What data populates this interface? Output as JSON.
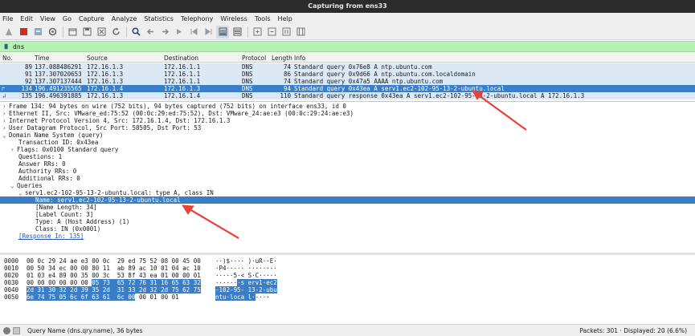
{
  "window": {
    "title": "Capturing from ens33"
  },
  "menu": [
    "File",
    "Edit",
    "View",
    "Go",
    "Capture",
    "Analyze",
    "Statistics",
    "Telephony",
    "Wireless",
    "Tools",
    "Help"
  ],
  "toolbar_icons": [
    "shark-fin-icon",
    "stop-icon",
    "restart-icon",
    "options-gear-icon",
    "open-folder-icon",
    "save-icon",
    "close-file-icon",
    "reload-icon",
    "search-icon",
    "back-arrow-icon",
    "forward-arrow-icon",
    "goto-packet-icon",
    "first-packet-icon",
    "last-packet-icon",
    "autoscroll-icon",
    "colorize-icon",
    "zoom-in-icon",
    "zoom-out-icon",
    "normal-size-icon",
    "resize-columns-icon"
  ],
  "filter": {
    "value": "dns"
  },
  "packet_list": {
    "headers": {
      "no": "No.",
      "time": "Time",
      "source": "Source",
      "destination": "Destination",
      "protocol": "Protocol",
      "length": "Length",
      "info": "Info"
    },
    "rows": [
      {
        "no": "89",
        "time": "137.088486291",
        "source": "172.16.1.3",
        "destination": "172.16.1.1",
        "protocol": "DNS",
        "length": "74",
        "info": "Standard query 0x76e8 A ntp.ubuntu.com"
      },
      {
        "no": "91",
        "time": "137.307020653",
        "source": "172.16.1.3",
        "destination": "172.16.1.1",
        "protocol": "DNS",
        "length": "86",
        "info": "Standard query 0x9d66 A ntp.ubuntu.com.localdomain"
      },
      {
        "no": "92",
        "time": "137.307137444",
        "source": "172.16.1.3",
        "destination": "172.16.1.1",
        "protocol": "DNS",
        "length": "74",
        "info": "Standard query 0x47a5 AAAA ntp.ubuntu.com"
      },
      {
        "no": "134",
        "time": "196.491235565",
        "source": "172.16.1.4",
        "destination": "172.16.1.3",
        "protocol": "DNS",
        "length": "94",
        "info": "Standard query 0x43ea A serv1.ec2-102-95-13-2-ubuntu.local"
      },
      {
        "no": "135",
        "time": "196.496391885",
        "source": "172.16.1.3",
        "destination": "172.16.1.4",
        "protocol": "DNS",
        "length": "110",
        "info": "Standard query response 0x43ea A serv1.ec2-102-95-13-2-ubuntu.local A 172.16.1.3"
      }
    ]
  },
  "details": {
    "frame": "Frame 134: 94 bytes on wire (752 bits), 94 bytes captured (752 bits) on interface ens33, id 0",
    "ethernet": "Ethernet II, Src: VMware_ed:75:52 (00:0c:29:ed:75:52), Dst: VMware_24:ae:e3 (00:0c:29:24:ae:e3)",
    "ip": "Internet Protocol Version 4, Src: 172.16.1.4, Dst: 172.16.1.3",
    "udp": "User Datagram Protocol, Src Port: 58505, Dst Port: 53",
    "dns": "Domain Name System (query)",
    "transaction_id": "Transaction ID: 0x43ea",
    "flags": "Flags: 0x0100 Standard query",
    "questions": "Questions: 1",
    "answer_rrs": "Answer RRs: 0",
    "authority_rrs": "Authority RRs: 0",
    "additional_rrs": "Additional RRs: 0",
    "queries": "Queries",
    "query": "serv1.ec2-102-95-13-2-ubuntu.local: type A, class IN",
    "name": "Name: serv1.ec2-102-95-13-2-ubuntu.local",
    "name_length": "[Name Length: 34]",
    "label_count": "[Label Count: 3]",
    "type": "Type: A (Host Address) (1)",
    "class": "Class: IN (0x0001)",
    "response_in": "[Response In: 135]"
  },
  "bytes": {
    "rows": [
      {
        "offset": "0000",
        "hex_a": "00 0c 29 24 ae e3 00 0c  29 ed 75 52 08 00 45 00",
        "hex_b": "",
        "ascii_a": "··)$···· )·uR··E·",
        "ascii_b": ""
      },
      {
        "offset": "0010",
        "hex_a": "00 50 34 ec 00 00 80 11  ab 89 ac 10 01 04 ac 10",
        "hex_b": "",
        "ascii_a": "·P4····· ········",
        "ascii_b": ""
      },
      {
        "offset": "0020",
        "hex_a": "01 03 e4 89 00 35 00 3c  53 8f 43 ea 01 00 00 01",
        "hex_b": "",
        "ascii_a": "·····5·< S·C·····",
        "ascii_b": ""
      },
      {
        "offset": "0030",
        "hex_a": "00 00 00 00 00 00 ",
        "hex_b": "05 73  65 72 76 31 16 65 63 32",
        "ascii_a": "······",
        "ascii_b": "·s erv1·ec2"
      },
      {
        "offset": "0040",
        "hex_a": "",
        "hex_b": "2d 31 30 32 2d 39 35 2d  31 33 2d 32 2d 75 62 75",
        "ascii_a": "",
        "ascii_b": "-102-95- 13-2-ubu"
      },
      {
        "offset": "0050",
        "hex_a": "",
        "hex_b": "6e 74 75 05 6c 6f 63 61  6c 00",
        "hex_c": " 00 01 00 01",
        "ascii_a": "",
        "ascii_b": "ntu·loca l·",
        "ascii_c": "····"
      }
    ]
  },
  "status": {
    "left": "Query Name (dns.qry.name), 36 bytes",
    "right": "Packets: 301 · Displayed: 20 (6.6%)"
  },
  "colors": {
    "selection": "#3a7ec7",
    "dns_row": "#dbe8f6",
    "filter_bg": "#b5f3b2",
    "annotation_arrow": "#e8423a"
  }
}
